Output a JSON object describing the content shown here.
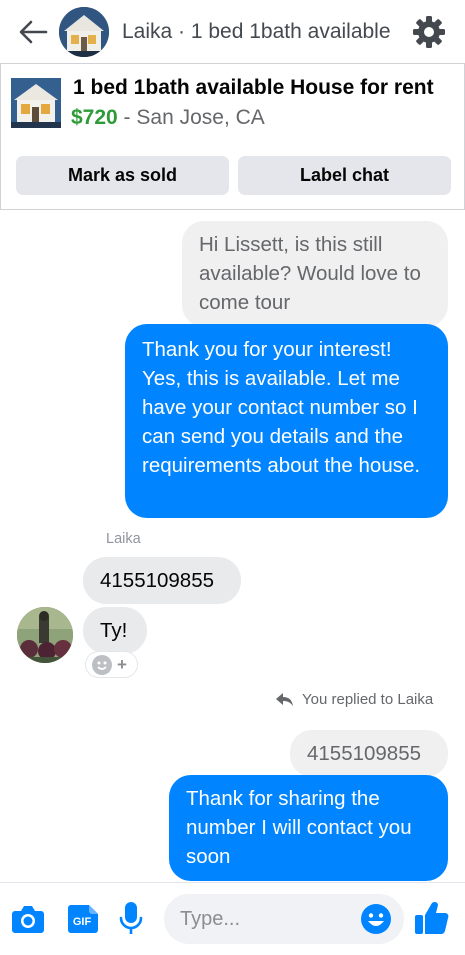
{
  "header": {
    "title": "Laika · 1 bed 1bath available",
    "back_icon": "arrow-left-icon",
    "settings_icon": "gear-icon"
  },
  "listing": {
    "title": "1 bed 1bath available House for rent",
    "price": "$720",
    "separator": " - ",
    "location": "San Jose, CA",
    "mark_sold_label": "Mark as sold",
    "label_chat_label": "Label chat"
  },
  "messages": [
    {
      "from": "me",
      "style": "forwarded-grey",
      "text": "Hi Lissett, is this still available? Would love to come tour"
    },
    {
      "from": "me",
      "style": "blue",
      "text": "Thank you for your interest! Yes, this is available. Let me have your contact number so I can send you details and the requirements about the house."
    },
    {
      "from": "Laika",
      "style": "grey",
      "text": "4155109855"
    },
    {
      "from": "Laika",
      "style": "grey",
      "text": "Ty!"
    },
    {
      "from": "me",
      "style": "quoted-grey",
      "text": "4155109855"
    },
    {
      "from": "me",
      "style": "blue",
      "text": "Thank for sharing  the number I will contact you soon"
    }
  ],
  "sender_name": "Laika",
  "reply_notice": "You replied to Laika",
  "composer": {
    "placeholder": "Type...",
    "gif_label": "GIF",
    "icons": [
      "camera-icon",
      "gif-icon",
      "microphone-icon",
      "emoji-icon",
      "thumbs-up-icon"
    ]
  },
  "colors": {
    "accent": "#0084ff",
    "price_green": "#2e9b39",
    "bubble_grey": "#f0f0f0"
  }
}
